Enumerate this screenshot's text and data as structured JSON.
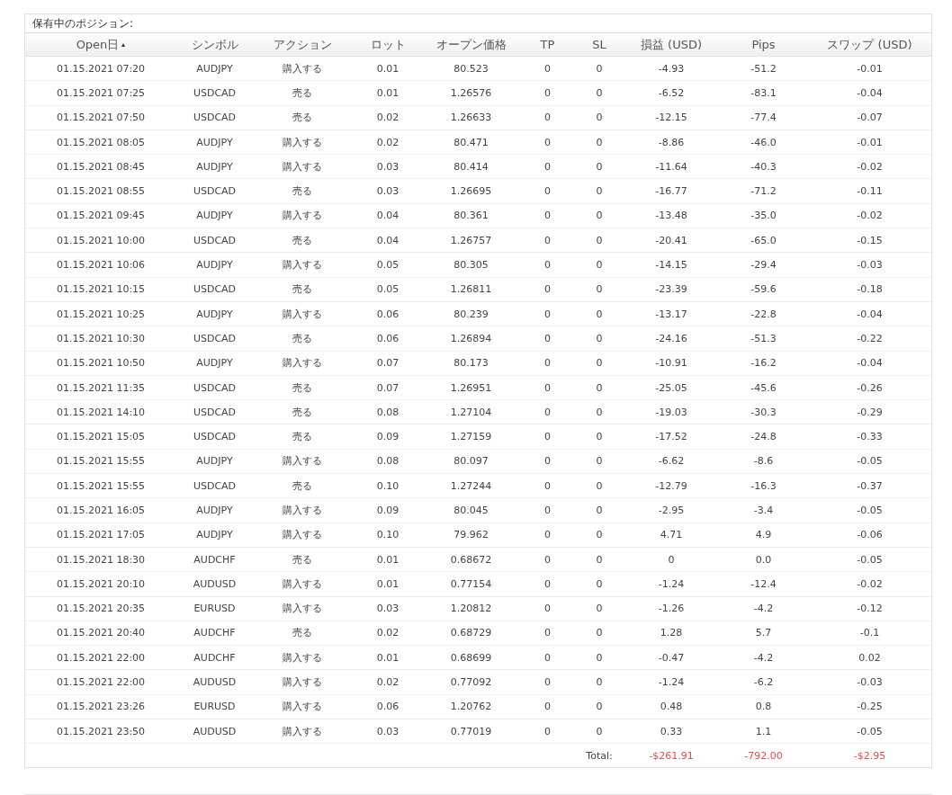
{
  "panel": {
    "title": "保有中のポジション:"
  },
  "table": {
    "columns": [
      {
        "label": "Open日",
        "sorted": true
      },
      {
        "label": "シンボル",
        "sorted": false
      },
      {
        "label": "アクション",
        "sorted": false
      },
      {
        "label": "ロット",
        "sorted": false
      },
      {
        "label": "オープン価格",
        "sorted": false
      },
      {
        "label": "TP",
        "sorted": false
      },
      {
        "label": "SL",
        "sorted": false
      },
      {
        "label": "損益 (USD)",
        "sorted": false
      },
      {
        "label": "Pips",
        "sorted": false
      },
      {
        "label": "スワップ (USD)",
        "sorted": false
      }
    ],
    "rows": [
      [
        "01.15.2021 07:20",
        "AUDJPY",
        "購入する",
        "0.01",
        "80.523",
        "0",
        "0",
        "-4.93",
        "-51.2",
        "-0.01"
      ],
      [
        "01.15.2021 07:25",
        "USDCAD",
        "売る",
        "0.01",
        "1.26576",
        "0",
        "0",
        "-6.52",
        "-83.1",
        "-0.04"
      ],
      [
        "01.15.2021 07:50",
        "USDCAD",
        "売る",
        "0.02",
        "1.26633",
        "0",
        "0",
        "-12.15",
        "-77.4",
        "-0.07"
      ],
      [
        "01.15.2021 08:05",
        "AUDJPY",
        "購入する",
        "0.02",
        "80.471",
        "0",
        "0",
        "-8.86",
        "-46.0",
        "-0.01"
      ],
      [
        "01.15.2021 08:45",
        "AUDJPY",
        "購入する",
        "0.03",
        "80.414",
        "0",
        "0",
        "-11.64",
        "-40.3",
        "-0.02"
      ],
      [
        "01.15.2021 08:55",
        "USDCAD",
        "売る",
        "0.03",
        "1.26695",
        "0",
        "0",
        "-16.77",
        "-71.2",
        "-0.11"
      ],
      [
        "01.15.2021 09:45",
        "AUDJPY",
        "購入する",
        "0.04",
        "80.361",
        "0",
        "0",
        "-13.48",
        "-35.0",
        "-0.02"
      ],
      [
        "01.15.2021 10:00",
        "USDCAD",
        "売る",
        "0.04",
        "1.26757",
        "0",
        "0",
        "-20.41",
        "-65.0",
        "-0.15"
      ],
      [
        "01.15.2021 10:06",
        "AUDJPY",
        "購入する",
        "0.05",
        "80.305",
        "0",
        "0",
        "-14.15",
        "-29.4",
        "-0.03"
      ],
      [
        "01.15.2021 10:15",
        "USDCAD",
        "売る",
        "0.05",
        "1.26811",
        "0",
        "0",
        "-23.39",
        "-59.6",
        "-0.18"
      ],
      [
        "01.15.2021 10:25",
        "AUDJPY",
        "購入する",
        "0.06",
        "80.239",
        "0",
        "0",
        "-13.17",
        "-22.8",
        "-0.04"
      ],
      [
        "01.15.2021 10:30",
        "USDCAD",
        "売る",
        "0.06",
        "1.26894",
        "0",
        "0",
        "-24.16",
        "-51.3",
        "-0.22"
      ],
      [
        "01.15.2021 10:50",
        "AUDJPY",
        "購入する",
        "0.07",
        "80.173",
        "0",
        "0",
        "-10.91",
        "-16.2",
        "-0.04"
      ],
      [
        "01.15.2021 11:35",
        "USDCAD",
        "売る",
        "0.07",
        "1.26951",
        "0",
        "0",
        "-25.05",
        "-45.6",
        "-0.26"
      ],
      [
        "01.15.2021 14:10",
        "USDCAD",
        "売る",
        "0.08",
        "1.27104",
        "0",
        "0",
        "-19.03",
        "-30.3",
        "-0.29"
      ],
      [
        "01.15.2021 15:05",
        "USDCAD",
        "売る",
        "0.09",
        "1.27159",
        "0",
        "0",
        "-17.52",
        "-24.8",
        "-0.33"
      ],
      [
        "01.15.2021 15:55",
        "AUDJPY",
        "購入する",
        "0.08",
        "80.097",
        "0",
        "0",
        "-6.62",
        "-8.6",
        "-0.05"
      ],
      [
        "01.15.2021 15:55",
        "USDCAD",
        "売る",
        "0.10",
        "1.27244",
        "0",
        "0",
        "-12.79",
        "-16.3",
        "-0.37"
      ],
      [
        "01.15.2021 16:05",
        "AUDJPY",
        "購入する",
        "0.09",
        "80.045",
        "0",
        "0",
        "-2.95",
        "-3.4",
        "-0.05"
      ],
      [
        "01.15.2021 17:05",
        "AUDJPY",
        "購入する",
        "0.10",
        "79.962",
        "0",
        "0",
        "4.71",
        "4.9",
        "-0.06"
      ],
      [
        "01.15.2021 18:30",
        "AUDCHF",
        "売る",
        "0.01",
        "0.68672",
        "0",
        "0",
        "0",
        "0.0",
        "-0.05"
      ],
      [
        "01.15.2021 20:10",
        "AUDUSD",
        "購入する",
        "0.01",
        "0.77154",
        "0",
        "0",
        "-1.24",
        "-12.4",
        "-0.02"
      ],
      [
        "01.15.2021 20:35",
        "EURUSD",
        "購入する",
        "0.03",
        "1.20812",
        "0",
        "0",
        "-1.26",
        "-4.2",
        "-0.12"
      ],
      [
        "01.15.2021 20:40",
        "AUDCHF",
        "売る",
        "0.02",
        "0.68729",
        "0",
        "0",
        "1.28",
        "5.7",
        "-0.1"
      ],
      [
        "01.15.2021 22:00",
        "AUDCHF",
        "購入する",
        "0.01",
        "0.68699",
        "0",
        "0",
        "-0.47",
        "-4.2",
        "0.02"
      ],
      [
        "01.15.2021 22:00",
        "AUDUSD",
        "購入する",
        "0.02",
        "0.77092",
        "0",
        "0",
        "-1.24",
        "-6.2",
        "-0.03"
      ],
      [
        "01.15.2021 23:26",
        "EURUSD",
        "購入する",
        "0.06",
        "1.20762",
        "0",
        "0",
        "0.48",
        "0.8",
        "-0.25"
      ],
      [
        "01.15.2021 23:50",
        "AUDUSD",
        "購入する",
        "0.03",
        "0.77019",
        "0",
        "0",
        "0.33",
        "1.1",
        "-0.05"
      ]
    ],
    "totals": {
      "label": "Total:",
      "profit": "-$261.91",
      "pips": "-792.00",
      "swap": "-$2.95"
    }
  }
}
